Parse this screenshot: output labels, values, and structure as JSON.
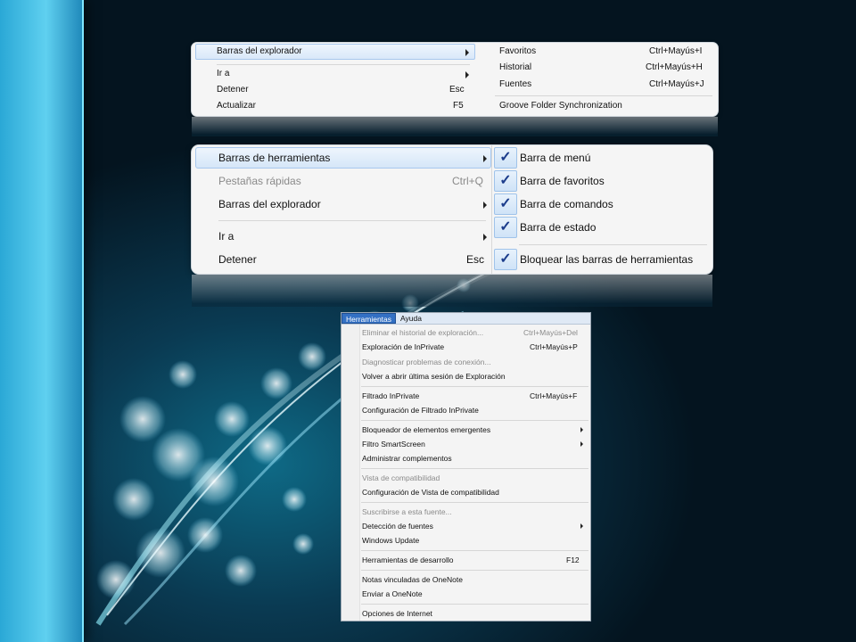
{
  "panel1": {
    "left_items": [
      {
        "label": "Barras del explorador",
        "shortcut": "",
        "submenu": true,
        "disabled": false
      },
      {
        "label": "Ir a",
        "shortcut": "",
        "submenu": true,
        "disabled": false
      },
      {
        "label": "Detener",
        "shortcut": "Esc",
        "submenu": false,
        "disabled": false
      },
      {
        "label": "Actualizar",
        "shortcut": "F5",
        "submenu": false,
        "disabled": false
      }
    ],
    "right_items": [
      {
        "label": "Favoritos",
        "shortcut": "Ctrl+Mayús+I"
      },
      {
        "label": "Historial",
        "shortcut": "Ctrl+Mayús+H"
      },
      {
        "label": "Fuentes",
        "shortcut": "Ctrl+Mayús+J"
      },
      {
        "label": "Groove Folder Synchronization",
        "shortcut": ""
      }
    ]
  },
  "panel2": {
    "left_items": [
      {
        "label": "Barras de herramientas",
        "shortcut": "",
        "submenu": true,
        "disabled": false
      },
      {
        "label": "Pestañas rápidas",
        "shortcut": "Ctrl+Q",
        "submenu": false,
        "disabled": true
      },
      {
        "label": "Barras del explorador",
        "shortcut": "",
        "submenu": true,
        "disabled": false
      },
      {
        "label": "Ir a",
        "shortcut": "",
        "submenu": true,
        "disabled": false
      },
      {
        "label": "Detener",
        "shortcut": "Esc",
        "submenu": false,
        "disabled": false
      }
    ],
    "right_items": [
      {
        "label": "Barra de menú",
        "checked": true
      },
      {
        "label": "Barra de favoritos",
        "checked": true
      },
      {
        "label": "Barra de comandos",
        "checked": true
      },
      {
        "label": "Barra de estado",
        "checked": true
      },
      {
        "label": "Bloquear las barras de herramientas",
        "checked": true
      }
    ],
    "check_glyph": "✓"
  },
  "panel3": {
    "menubar": [
      "Herramientas",
      "Ayuda"
    ],
    "items": [
      {
        "label": "Eliminar el historial de exploración...",
        "shortcut": "Ctrl+Mayús+Del",
        "disabled": true
      },
      {
        "label": "Exploración de InPrivate",
        "shortcut": "Ctrl+Mayús+P",
        "disabled": false
      },
      {
        "label": "Diagnosticar problemas de conexión...",
        "shortcut": "",
        "disabled": true
      },
      {
        "label": "Volver a abrir última sesión de Exploración",
        "shortcut": "",
        "disabled": false
      },
      {
        "label": "Filtrado InPrivate",
        "shortcut": "Ctrl+Mayús+F",
        "disabled": false
      },
      {
        "label": "Configuración de Filtrado InPrivate",
        "shortcut": "",
        "disabled": false
      },
      {
        "label": "Bloqueador de elementos emergentes",
        "shortcut": "",
        "disabled": false,
        "submenu": true
      },
      {
        "label": "Filtro SmartScreen",
        "shortcut": "",
        "disabled": false,
        "submenu": true
      },
      {
        "label": "Administrar complementos",
        "shortcut": "",
        "disabled": false
      },
      {
        "label": "Vista de compatibilidad",
        "shortcut": "",
        "disabled": true
      },
      {
        "label": "Configuración de Vista de compatibilidad",
        "shortcut": "",
        "disabled": false
      },
      {
        "label": "Suscribirse a esta fuente...",
        "shortcut": "",
        "disabled": true
      },
      {
        "label": "Detección de fuentes",
        "shortcut": "",
        "disabled": false,
        "submenu": true
      },
      {
        "label": "Windows Update",
        "shortcut": "",
        "disabled": false
      },
      {
        "label": "Herramientas de desarrollo",
        "shortcut": "F12",
        "disabled": false
      },
      {
        "label": "Notas vinculadas de OneNote",
        "shortcut": "",
        "disabled": false
      },
      {
        "label": "Enviar a OneNote",
        "shortcut": "",
        "disabled": false
      },
      {
        "label": "Opciones de Internet",
        "shortcut": "",
        "disabled": false
      }
    ]
  },
  "colors": {
    "accent_blue": "#3370c4",
    "check_blue": "#1c3d8c",
    "background_dark": "#04141f",
    "left_bar": "#2aa8d6"
  }
}
